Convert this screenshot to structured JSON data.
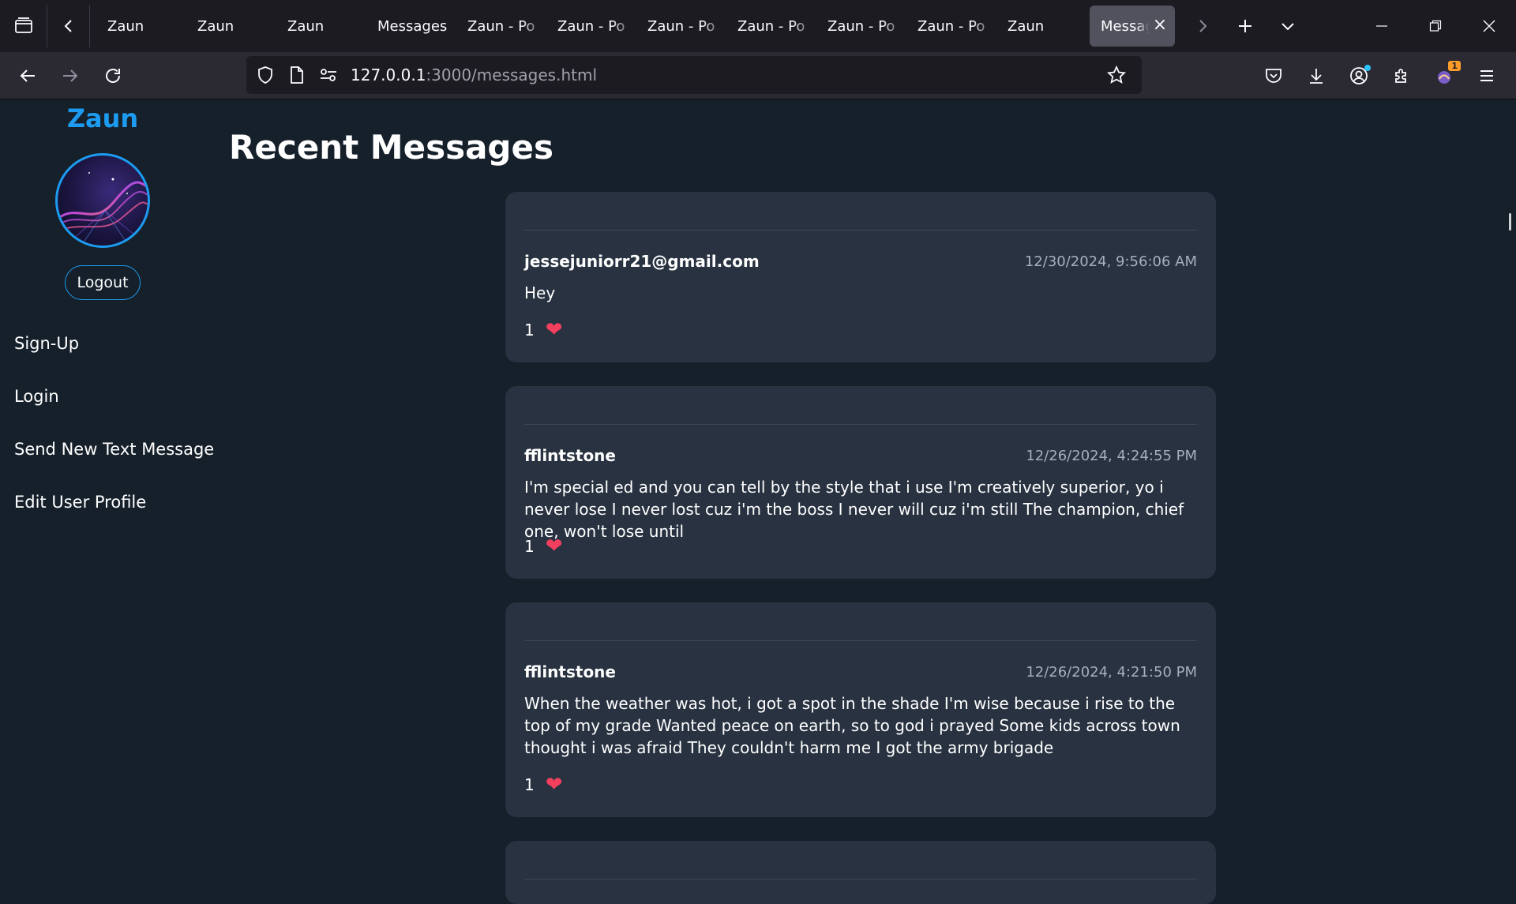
{
  "browser": {
    "tabs": [
      {
        "title": "Zaun"
      },
      {
        "title": "Zaun"
      },
      {
        "title": "Zaun"
      },
      {
        "title": "Messages"
      },
      {
        "title": "Zaun - Po"
      },
      {
        "title": "Zaun - Po"
      },
      {
        "title": "Zaun - Po"
      },
      {
        "title": "Zaun - Po"
      },
      {
        "title": "Zaun - Po"
      },
      {
        "title": "Zaun - Po"
      },
      {
        "title": "Zaun"
      }
    ],
    "active_tab": {
      "title": "Messag"
    },
    "url_host": "127.0.0.1",
    "url_path": ":3000/messages.html",
    "extension_badge": "1"
  },
  "sidebar": {
    "brand": "Zaun",
    "logout_label": "Logout",
    "links": [
      {
        "label": "Sign-Up"
      },
      {
        "label": "Login"
      },
      {
        "label": "Send New Text Message"
      },
      {
        "label": "Edit User Profile"
      }
    ]
  },
  "main": {
    "title": "Recent Messages",
    "messages": [
      {
        "author": "jessejuniorr21@gmail.com",
        "timestamp": "12/30/2024, 9:56:06 AM",
        "text": "Hey",
        "likes": "1"
      },
      {
        "author": "fflintstone",
        "timestamp": "12/26/2024, 4:24:55 PM",
        "text": "I'm special ed and you can tell by the style that i use I'm creatively superior, yo i never lose I never lost cuz i'm the boss I never will cuz i'm still The champion, chief one, won't lose until",
        "likes": "1"
      },
      {
        "author": "fflintstone",
        "timestamp": "12/26/2024, 4:21:50 PM",
        "text": "When the weather was hot, i got a spot in the shade I'm wise because i rise to the top of my grade Wanted peace on earth, so to god i prayed Some kids across town thought i was afraid They couldn't harm me I got the army brigade",
        "likes": "1"
      }
    ]
  },
  "colors": {
    "accent": "#1d9bf0",
    "background": "#15202b",
    "card": "#283240",
    "heart": "#f43f5e"
  }
}
